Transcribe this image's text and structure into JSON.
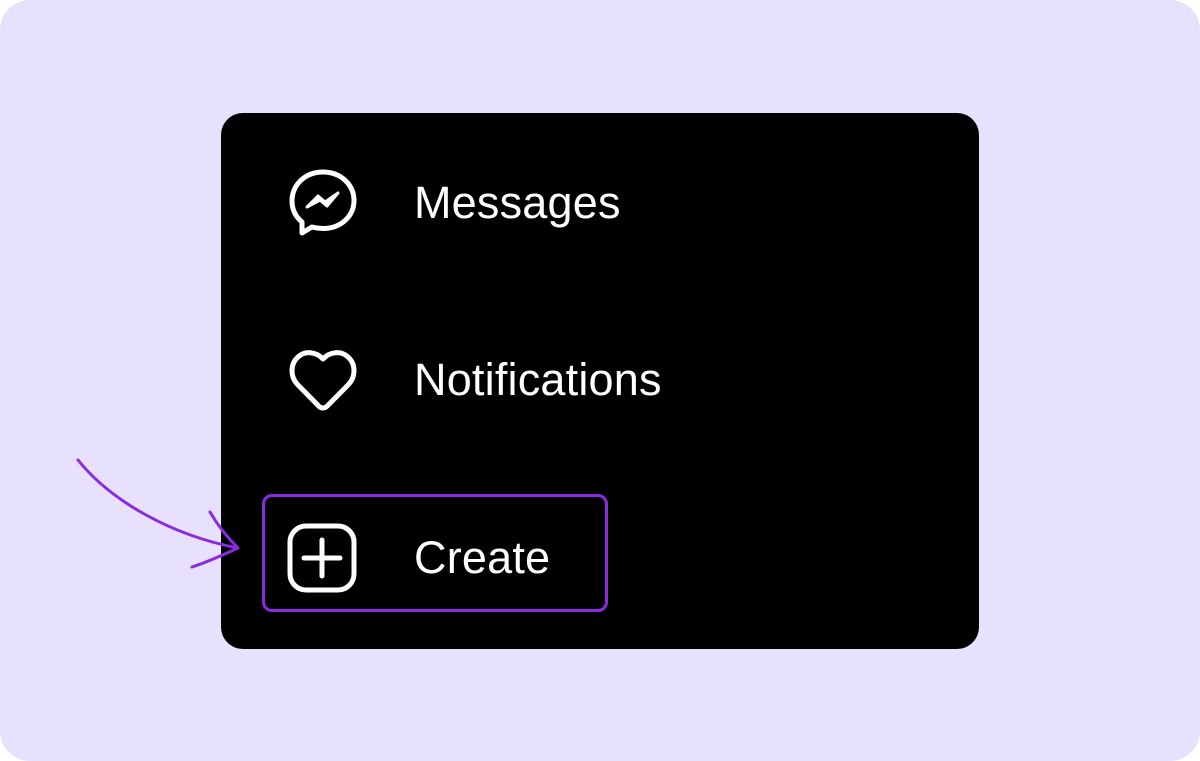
{
  "colors": {
    "background": "#e8e1fd",
    "panel": "#000000",
    "text": "#ffffff",
    "accent": "#8a2be2"
  },
  "menu": {
    "items": [
      {
        "label": "Messages",
        "icon": "messenger-icon"
      },
      {
        "label": "Notifications",
        "icon": "heart-icon"
      },
      {
        "label": "Create",
        "icon": "plus-square-icon"
      }
    ]
  },
  "annotation": {
    "highlighted_item": "Create",
    "pointer": "arrow-icon"
  }
}
